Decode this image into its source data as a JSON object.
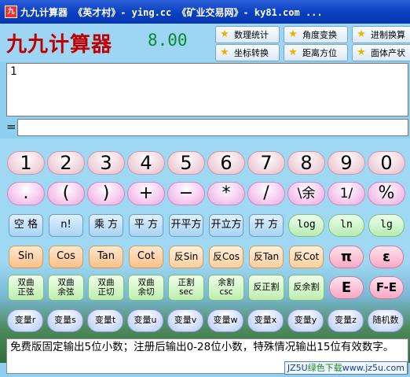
{
  "window": {
    "title": "九九计算器    《英才村》- ying.cc    《矿业交易网》- ky81.com ..."
  },
  "header": {
    "app_title": "九九计算器",
    "version": "8.00"
  },
  "toolbar": [
    {
      "label": "数理统计",
      "icon": "star-icon"
    },
    {
      "label": "角度变换",
      "icon": "star-icon"
    },
    {
      "label": "进制换算",
      "icon": "star-icon"
    },
    {
      "label": "坐标转换",
      "icon": "star-icon"
    },
    {
      "label": "距离方位",
      "icon": "star-icon"
    },
    {
      "label": "面体产状",
      "icon": "star-icon"
    }
  ],
  "expression_input": {
    "value": "1"
  },
  "result": {
    "prefix": "=",
    "value": ""
  },
  "keys": {
    "digits": [
      "1",
      "2",
      "3",
      "4",
      "5",
      "6",
      "7",
      "8",
      "9",
      "0"
    ],
    "ops": [
      ".",
      "(",
      ")",
      "+",
      "−",
      "*",
      "/",
      "\\余",
      "1/",
      "%"
    ],
    "row3": [
      "空 格",
      "n!",
      "乘 方",
      "平 方",
      "开平方",
      "开立方",
      "开 方",
      "log",
      "ln",
      "lg"
    ],
    "row4": [
      "Sin",
      "Cos",
      "Tan",
      "Cot",
      "反Sin",
      "反Cos",
      "反Tan",
      "反Cot",
      "π",
      "ε"
    ],
    "row5": [
      {
        "l1": "双曲",
        "l2": "正弦"
      },
      {
        "l1": "双曲",
        "l2": "余弦"
      },
      {
        "l1": "双曲",
        "l2": "正切"
      },
      {
        "l1": "双曲",
        "l2": "余切"
      },
      {
        "l1": "正割",
        "l2": "sec"
      },
      {
        "l1": "余割",
        "l2": "csc"
      },
      {
        "l1": "反正割",
        "l2": ""
      },
      {
        "l1": "反余割",
        "l2": ""
      },
      {
        "l1": "E",
        "l2": ""
      },
      {
        "l1": "F-E",
        "l2": ""
      }
    ],
    "row6": [
      "变量r",
      "变量s",
      "变量t",
      "变量u",
      "变量v",
      "变量w",
      "变量x",
      "变量y",
      "变量z",
      "随机数"
    ]
  },
  "notice": "免费版固定输出5位小数；注册后输出0-28位小数，特殊情况输出15位有效数字。",
  "watermark": {
    "part1": "JZ5U",
    "part2": "绿色下载",
    "part3": "www.jz5u.com"
  }
}
